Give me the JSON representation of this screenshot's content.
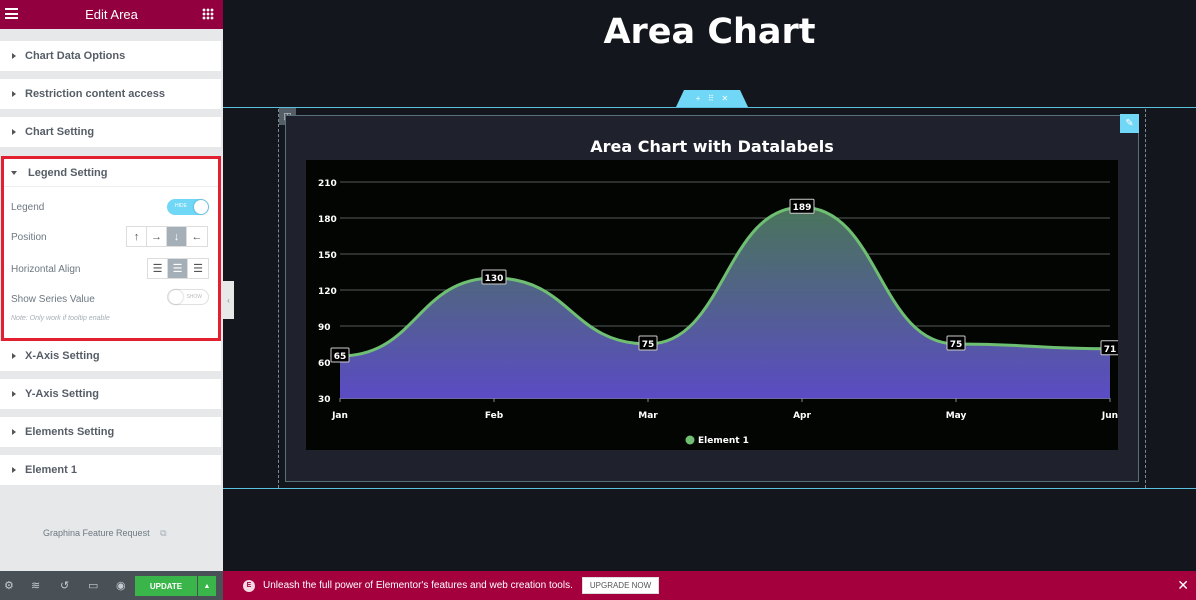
{
  "panel": {
    "title": "Edit Area",
    "sections": [
      {
        "label": "Chart Data Options"
      },
      {
        "label": "Restriction content access"
      },
      {
        "label": "Chart Setting"
      }
    ],
    "legend_setting": {
      "label": "Legend Setting",
      "legend": {
        "label": "Legend",
        "toggle_text": "HIDE",
        "enabled": true
      },
      "position": {
        "label": "Position",
        "options": [
          "up-arrow",
          "right-arrow",
          "down-arrow",
          "left-arrow"
        ],
        "selected": "down-arrow"
      },
      "horizontal_align": {
        "label": "Horizontal Align",
        "options": [
          "align-left",
          "align-center",
          "align-right"
        ],
        "selected": "align-center"
      },
      "show_series_value": {
        "label": "Show Series Value",
        "toggle_text": "SHOW",
        "enabled": false
      },
      "note": "Note: Only work if tooltip enable"
    },
    "sections_after": [
      {
        "label": "X-Axis Setting"
      },
      {
        "label": "Y-Axis Setting"
      },
      {
        "label": "Elements Setting"
      },
      {
        "label": "Element 1"
      }
    ],
    "feature_request": "Graphina Feature Request",
    "footer": {
      "update_label": "UPDATE"
    }
  },
  "canvas": {
    "page_title": "Area Chart",
    "notice": {
      "text": "Unleash the full power of Elementor's features and web creation tools.",
      "button": "UPGRADE NOW"
    }
  },
  "colors": {
    "brand": "#93003f",
    "accent": "#71d7f7",
    "update_green": "#39b54a",
    "series_line": "#6fbf73",
    "area_top": "#4d7a5f",
    "area_bottom": "#5b4bc4"
  },
  "chart_data": {
    "type": "area",
    "title": "Area Chart with Datalabels",
    "categories": [
      "Jan",
      "Feb",
      "Mar",
      "Apr",
      "May",
      "Jun"
    ],
    "series": [
      {
        "name": "Element 1",
        "values": [
          65,
          130,
          75,
          189,
          75,
          71
        ]
      }
    ],
    "yticks": [
      30,
      60,
      90,
      120,
      150,
      180,
      210
    ],
    "ylim": [
      30,
      210
    ],
    "xlabel": "",
    "ylabel": "",
    "grid": true,
    "legend": "bottom-center",
    "data_labels": true
  }
}
